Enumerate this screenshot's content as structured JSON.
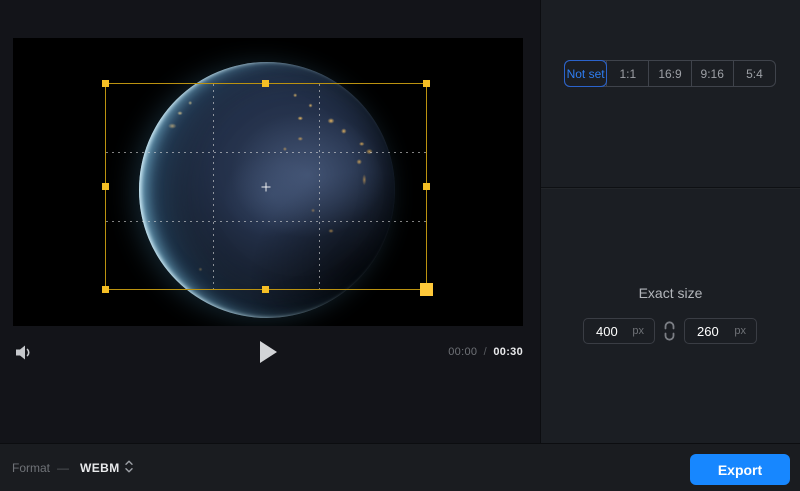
{
  "preview": {
    "player": {
      "current_time": "00:00",
      "separator": "/",
      "duration": "00:30"
    },
    "crop": {
      "grid": "thirds",
      "handle_count": 8
    }
  },
  "panel": {
    "aspect_ratio_options": [
      "Not set",
      "1:1",
      "16:9",
      "9:16",
      "5:4"
    ],
    "selected_aspect_ratio": "Not set",
    "exact_size": {
      "heading": "Exact size",
      "width_value": "400",
      "height_value": "260",
      "unit": "px"
    }
  },
  "footer": {
    "format_label": "Format",
    "format_separator": "—",
    "format_value": "WEBM",
    "export_label": "Export"
  },
  "colors": {
    "accent_blue": "#2f7df0",
    "export_blue": "#1787ff",
    "crop_border": "#bb9210",
    "crop_handle": "#f5bf25",
    "panel_bg": "#1b1e23",
    "page_bg": "#131419",
    "video_bg": "#000000"
  }
}
